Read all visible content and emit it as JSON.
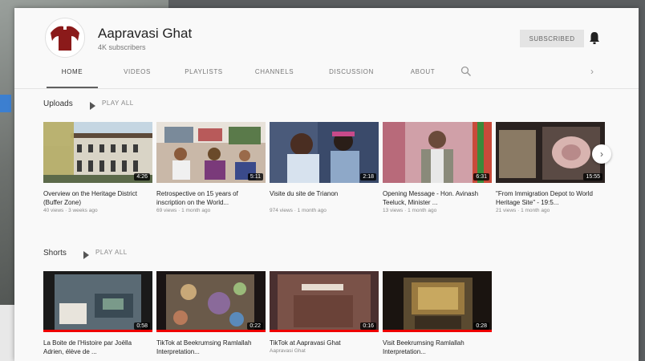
{
  "channel": {
    "title": "Aapravasi Ghat",
    "subscribers": "4K subscribers",
    "subscribe_label": "SUBSCRIBED"
  },
  "tabs": [
    {
      "label": "HOME",
      "active": true
    },
    {
      "label": "VIDEOS",
      "active": false
    },
    {
      "label": "PLAYLISTS",
      "active": false
    },
    {
      "label": "CHANNELS",
      "active": false
    },
    {
      "label": "DISCUSSION",
      "active": false
    },
    {
      "label": "ABOUT",
      "active": false
    }
  ],
  "uploads": {
    "title": "Uploads",
    "play_all": "PLAY ALL",
    "videos": [
      {
        "title": "Overview on the Heritage District (Buffer Zone)",
        "meta": "40 views · 3 weeks ago",
        "duration": "4:26"
      },
      {
        "title": "Retrospective on 15 years of inscription on the World...",
        "meta": "69 views · 1 month ago",
        "duration": "5:11"
      },
      {
        "title": "Visite du site de Trianon",
        "meta": "974 views · 1 month ago",
        "duration": "2:18"
      },
      {
        "title": "Opening Message - Hon. Avinash Teeluck, Minister ...",
        "meta": "13 views · 1 month ago",
        "duration": "6:31"
      },
      {
        "title": "\"From Immigration Depot to World Heritage Site\" - 19:5...",
        "meta": "21 views · 1 month ago",
        "duration": "15:55"
      }
    ]
  },
  "shorts": {
    "title": "Shorts",
    "play_all": "PLAY ALL",
    "videos": [
      {
        "title": "La Boite de l'Histoire par Joëlla Adrien, élève de ...",
        "meta": "",
        "duration": "0:58"
      },
      {
        "title": "TikTok at Beekrumsing Ramlallah Interpretation...",
        "meta": "",
        "duration": "0:22"
      },
      {
        "title": "TikTok at Aapravasi Ghat",
        "meta": "Aapravasi Ghat",
        "duration": "0:16"
      },
      {
        "title": "Visit Beekrumsing Ramlallah Interpretation...",
        "meta": "",
        "duration": "0:28"
      }
    ]
  },
  "colors": {
    "accent": "#ff0000",
    "logo": "#8b1a1a"
  }
}
